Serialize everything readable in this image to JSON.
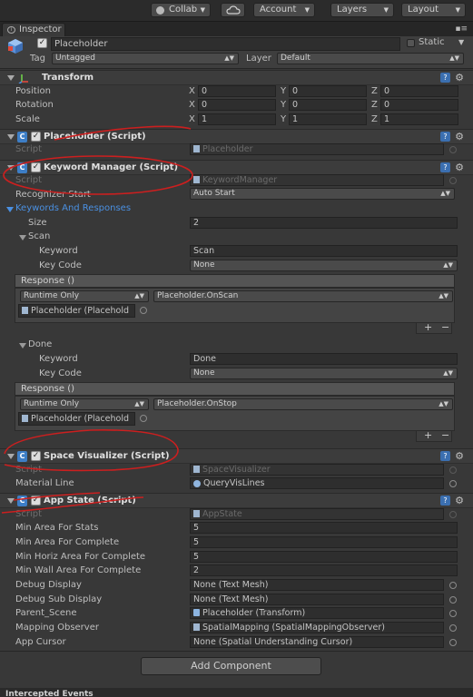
{
  "toolbar": {
    "collab": "Collab",
    "cloud_icon": "cloud-icon",
    "account": "Account",
    "layers": "Layers",
    "layout": "Layout"
  },
  "tab": {
    "label": "Inspector",
    "icon": "info-icon",
    "menu_icon": "tab-menu-icon"
  },
  "object": {
    "name": "Placeholder",
    "static_label": "Static",
    "tag_label": "Tag",
    "tag_value": "Untagged",
    "layer_label": "Layer",
    "layer_value": "Default"
  },
  "transform": {
    "title": "Transform",
    "rows": [
      {
        "label": "Position",
        "x": "0",
        "y": "0",
        "z": "0"
      },
      {
        "label": "Rotation",
        "x": "0",
        "y": "0",
        "z": "0"
      },
      {
        "label": "Scale",
        "x": "1",
        "y": "1",
        "z": "1"
      }
    ],
    "axis_x": "X",
    "axis_y": "Y",
    "axis_z": "Z"
  },
  "placeholder_script": {
    "title": "Placeholder (Script)",
    "script_label": "Script",
    "script_value": "Placeholder"
  },
  "keyword_manager": {
    "title": "Keyword Manager (Script)",
    "script_label": "Script",
    "script_value": "KeywordManager",
    "recognizer_label": "Recognizer Start",
    "recognizer_value": "Auto Start",
    "keywords_label": "Keywords And Responses",
    "size_label": "Size",
    "size_value": "2",
    "entries": [
      {
        "name": "Scan",
        "keyword_label": "Keyword",
        "keyword_value": "Scan",
        "keycode_label": "Key Code",
        "keycode_value": "None",
        "response_label": "Response ()",
        "runtime": "Runtime Only",
        "method": "Placeholder.OnScan",
        "target": "Placeholder (Placehold"
      },
      {
        "name": "Done",
        "keyword_label": "Keyword",
        "keyword_value": "Done",
        "keycode_label": "Key Code",
        "keycode_value": "None",
        "response_label": "Response ()",
        "runtime": "Runtime Only",
        "method": "Placeholder.OnStop",
        "target": "Placeholder (Placehold"
      }
    ],
    "plus": "+",
    "minus": "−"
  },
  "space_visualizer": {
    "title": "Space Visualizer (Script)",
    "script_label": "Script",
    "script_value": "SpaceVisualizer",
    "material_label": "Material Line",
    "material_value": "QueryVisLines"
  },
  "app_state": {
    "title": "App State (Script)",
    "script_label": "Script",
    "script_value": "AppState",
    "rows": [
      {
        "label": "Min Area For Stats",
        "value": "5"
      },
      {
        "label": "Min Area For Complete",
        "value": "5"
      },
      {
        "label": "Min Horiz Area For Complete",
        "value": "5"
      },
      {
        "label": "Min Wall Area For Complete",
        "value": "2"
      },
      {
        "label": "Debug Display",
        "value": "None (Text Mesh)"
      },
      {
        "label": "Debug Sub Display",
        "value": "None (Text Mesh)"
      },
      {
        "label": "Parent_Scene",
        "value": "Placeholder (Transform)"
      },
      {
        "label": "Mapping Observer",
        "value": "SpatialMapping (SpatialMappingObserver)"
      },
      {
        "label": "App Cursor",
        "value": "None (Spatial Understanding Cursor)"
      }
    ]
  },
  "add_component": "Add Component",
  "bottom_panel": "Intercepted Events",
  "accent_colors": {
    "annotation_red": "#cc1f1f",
    "link_blue": "#4a90e2"
  }
}
